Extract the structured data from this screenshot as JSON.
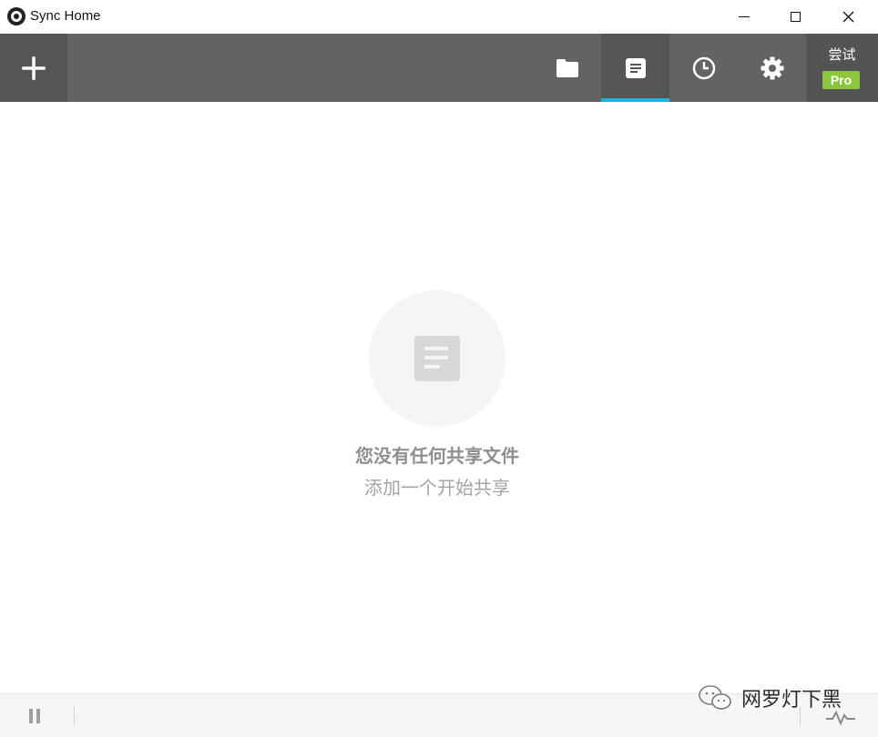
{
  "window": {
    "title": "Sync Home",
    "controls": {
      "minimize": "minimize",
      "maximize": "maximize",
      "close": "close"
    }
  },
  "toolbar": {
    "add_icon": "plus-icon",
    "tabs": [
      {
        "icon": "folder-icon",
        "active": false
      },
      {
        "icon": "document-icon",
        "active": true
      },
      {
        "icon": "clock-icon",
        "active": false
      },
      {
        "icon": "gear-icon",
        "active": false
      }
    ],
    "trial_label": "尝试",
    "pro_badge": "Pro",
    "colors": {
      "bar": "#636363",
      "active_tab": "#555555",
      "underline": "#18b4e8",
      "pro": "#8cc63f"
    }
  },
  "empty_state": {
    "icon": "document-icon",
    "title": "您没有任何共享文件",
    "subtitle": "添加一个开始共享"
  },
  "statusbar": {
    "pause_icon": "pause-icon",
    "activity_icon": "activity-icon"
  },
  "watermark": {
    "logo": "wechat-icon",
    "text": "网罗灯下黑"
  }
}
